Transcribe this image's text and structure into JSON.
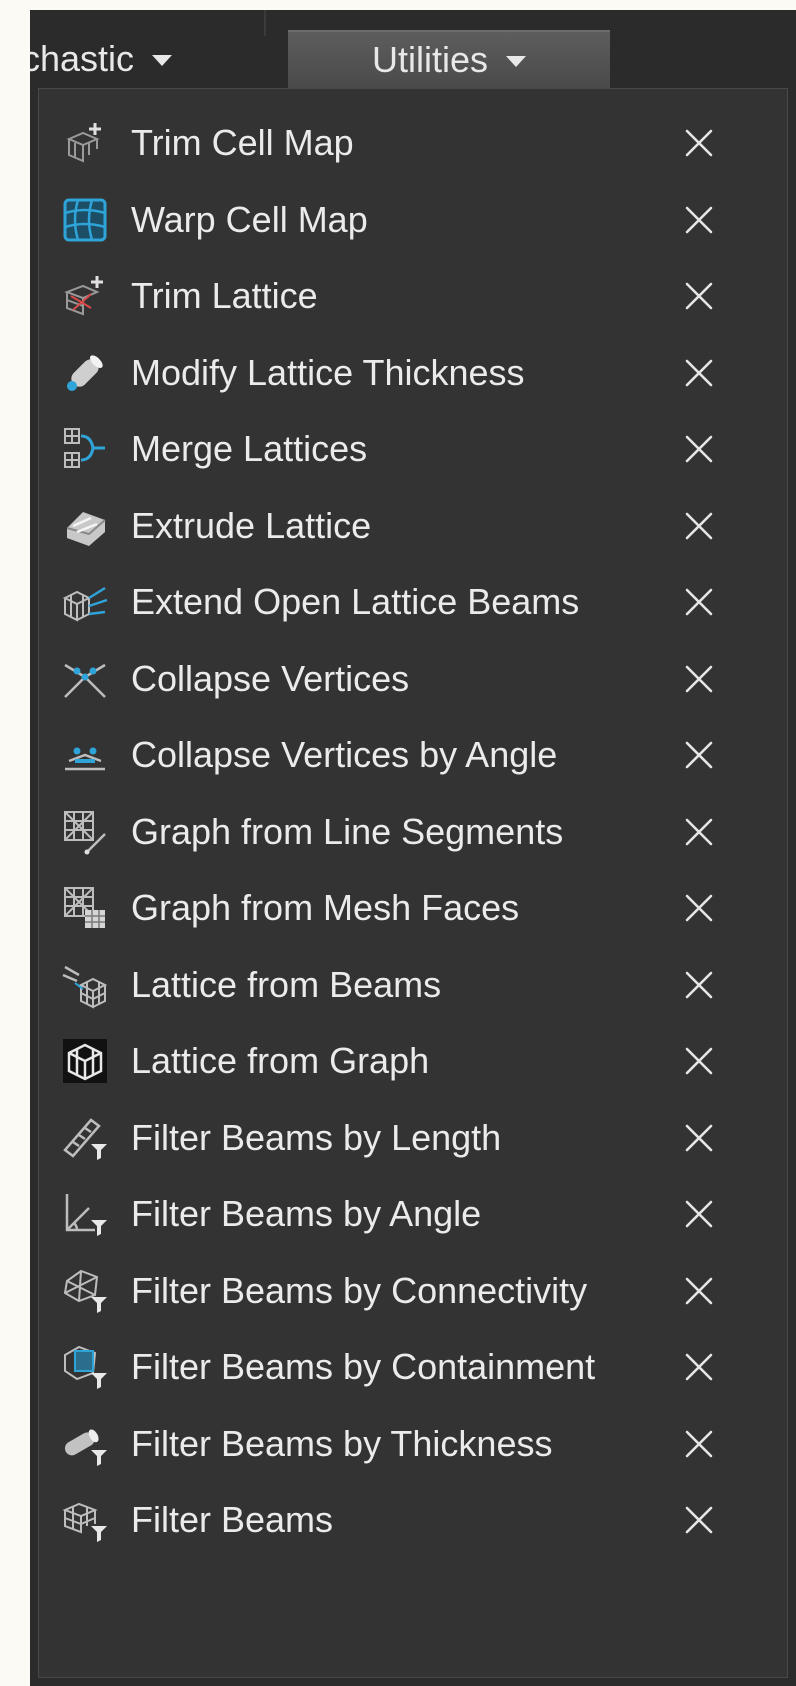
{
  "menubar": {
    "tabs": [
      {
        "label": "chastic"
      },
      {
        "label": "Utilities"
      }
    ]
  },
  "dropdown": {
    "items": [
      {
        "label": "Trim Cell Map",
        "icon": "trim-cell-map-icon"
      },
      {
        "label": "Warp Cell Map",
        "icon": "warp-cell-map-icon"
      },
      {
        "label": "Trim Lattice",
        "icon": "trim-lattice-icon"
      },
      {
        "label": "Modify Lattice Thickness",
        "icon": "modify-lattice-thickness-icon"
      },
      {
        "label": "Merge Lattices",
        "icon": "merge-lattices-icon"
      },
      {
        "label": "Extrude Lattice",
        "icon": "extrude-lattice-icon"
      },
      {
        "label": "Extend Open Lattice Beams",
        "icon": "extend-open-lattice-beams-icon"
      },
      {
        "label": "Collapse Vertices",
        "icon": "collapse-vertices-icon"
      },
      {
        "label": "Collapse Vertices by Angle",
        "icon": "collapse-vertices-by-angle-icon"
      },
      {
        "label": "Graph from Line Segments",
        "icon": "graph-from-line-segments-icon"
      },
      {
        "label": "Graph from Mesh Faces",
        "icon": "graph-from-mesh-faces-icon"
      },
      {
        "label": "Lattice from Beams",
        "icon": "lattice-from-beams-icon"
      },
      {
        "label": "Lattice from Graph",
        "icon": "lattice-from-graph-icon"
      },
      {
        "label": "Filter Beams by Length",
        "icon": "filter-beams-by-length-icon"
      },
      {
        "label": "Filter Beams by Angle",
        "icon": "filter-beams-by-angle-icon"
      },
      {
        "label": "Filter Beams by Connectivity",
        "icon": "filter-beams-by-connectivity-icon"
      },
      {
        "label": "Filter Beams by Containment",
        "icon": "filter-beams-by-containment-icon"
      },
      {
        "label": "Filter Beams by Thickness",
        "icon": "filter-beams-by-thickness-icon"
      },
      {
        "label": "Filter Beams",
        "icon": "filter-beams-icon"
      }
    ],
    "remove_icon": "close-icon"
  },
  "colors": {
    "panel_background": "#333333",
    "accent_blue": "#2fa4d8",
    "text": "#ebebeb"
  }
}
